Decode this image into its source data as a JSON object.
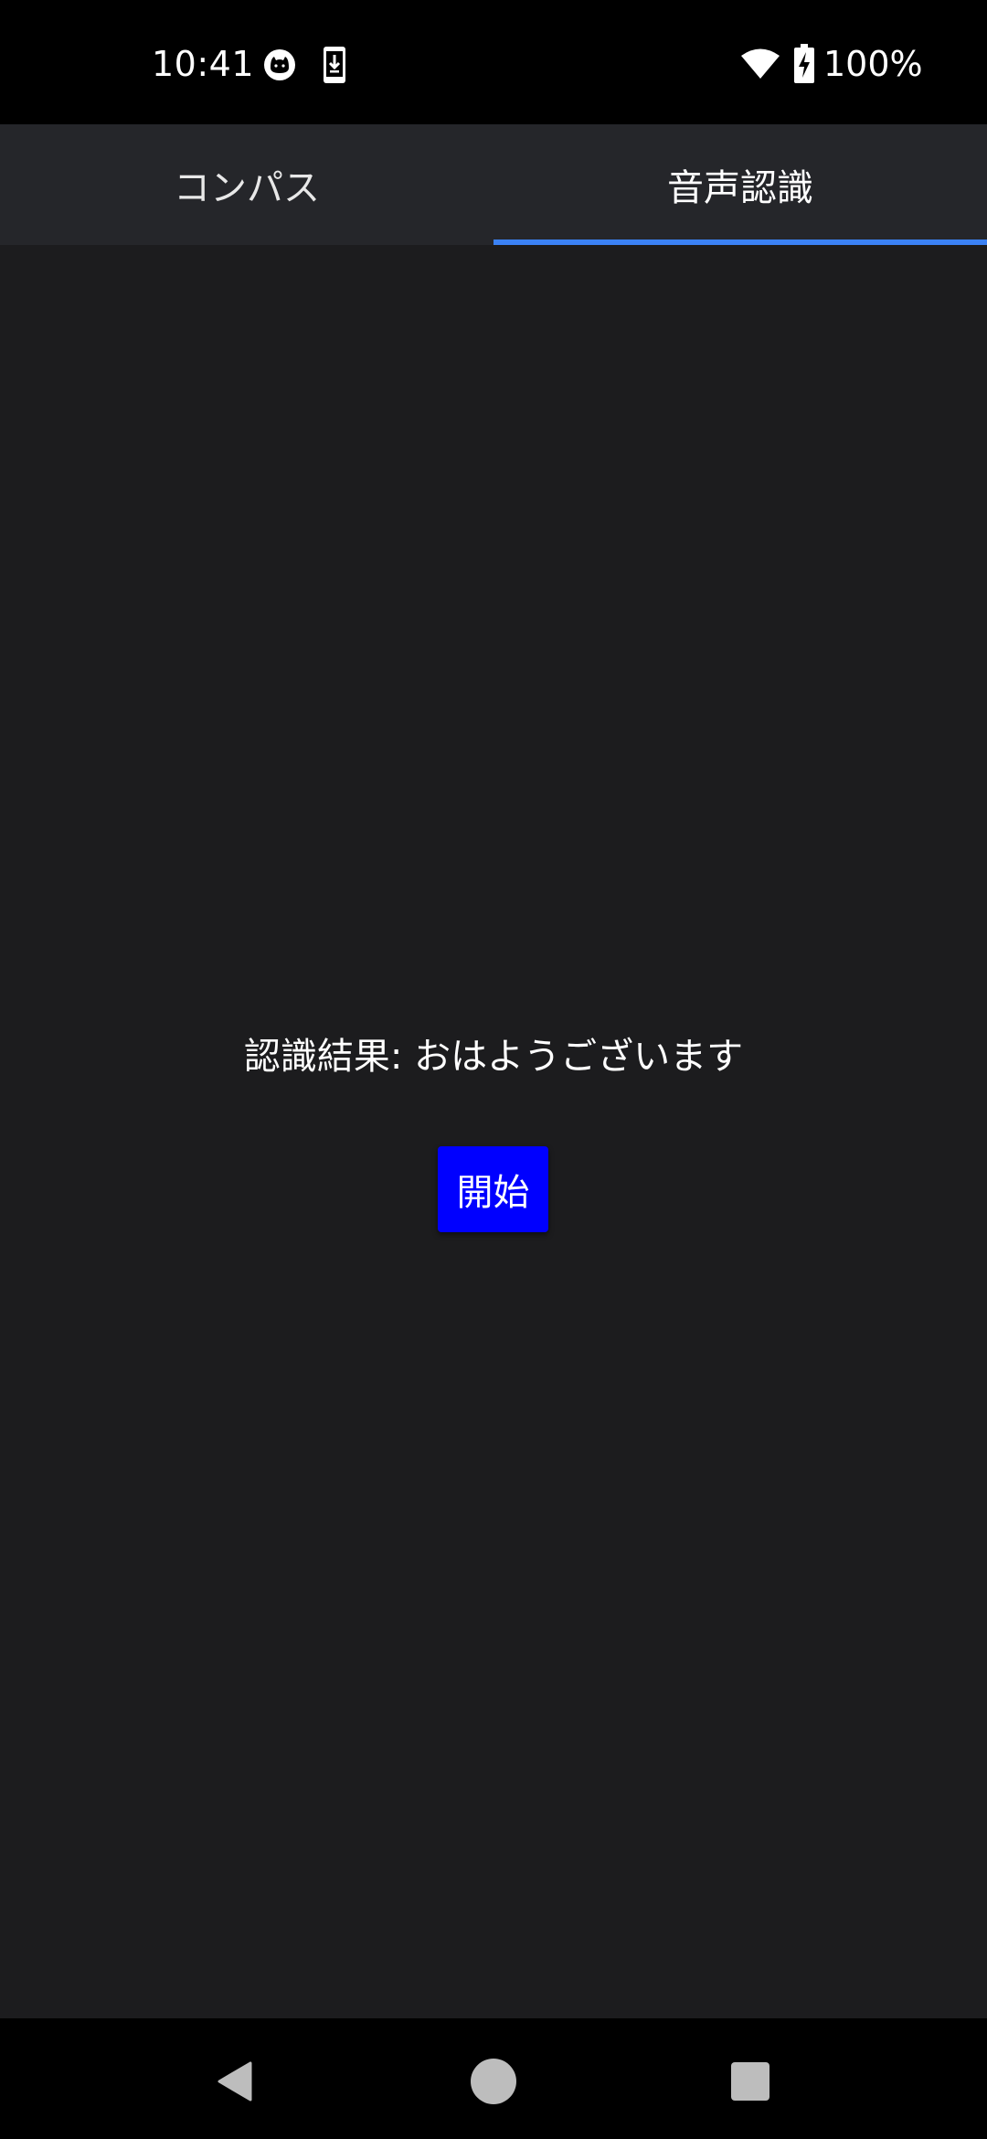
{
  "status_bar": {
    "time": "10:41",
    "battery_percent": "100%",
    "icons": [
      "cat-face-icon",
      "download-icon",
      "wifi-icon",
      "battery-charging-icon"
    ]
  },
  "tabs": [
    {
      "label": "コンパス",
      "selected": false
    },
    {
      "label": "音声認識",
      "selected": true
    }
  ],
  "main": {
    "result_text": "認識結果: おはようございます",
    "start_button_label": "開始"
  },
  "nav_bar": {
    "buttons": [
      "back-icon",
      "home-icon",
      "recents-icon"
    ]
  },
  "colors": {
    "status_bar_bg": "#000000",
    "tab_bar_bg": "#25262a",
    "tab_indicator": "#3b82f6",
    "content_bg": "#1c1c1e",
    "button_bg": "#0000ff",
    "nav_bar_bg": "#000000"
  }
}
